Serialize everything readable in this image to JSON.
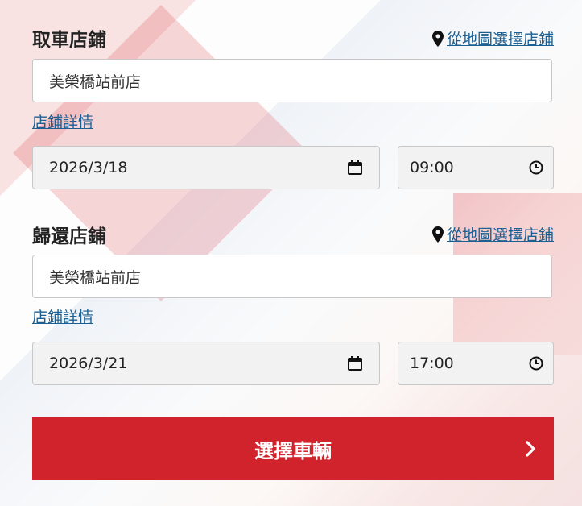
{
  "pickup": {
    "title": "取車店鋪",
    "map_link": "從地圖選擇店鋪",
    "store": "美榮橋站前店",
    "store_details": "店鋪詳情",
    "date": "2026/3/18",
    "time": "09:00"
  },
  "return": {
    "title": "歸還店鋪",
    "map_link": "從地圖選擇店鋪",
    "store": "美榮橋站前店",
    "store_details": "店鋪詳情",
    "date": "2026/3/21",
    "time": "17:00"
  },
  "submit": {
    "label": "選擇車輛"
  },
  "colors": {
    "accent": "#d0232b",
    "link": "#1b5f93"
  },
  "icons": [
    "map-pin-icon",
    "calendar-icon",
    "clock-icon",
    "chevron-right-icon"
  ]
}
